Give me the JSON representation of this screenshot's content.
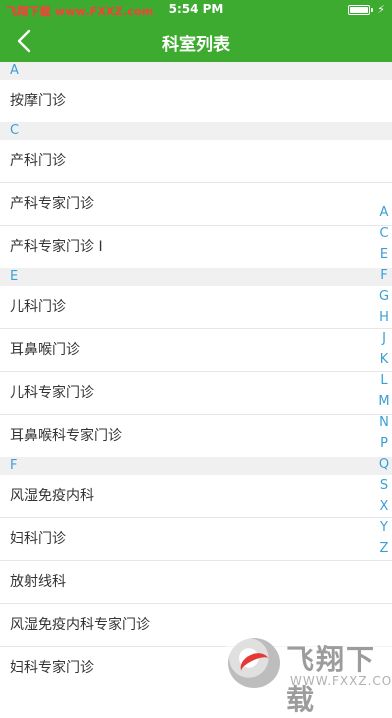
{
  "status_bar": {
    "site": "飞翔下载 www.FXXZ.com",
    "time": "5:54 PM",
    "charge_icon": "⚡"
  },
  "nav": {
    "title": "科室列表",
    "back_icon": "chevron-left-icon"
  },
  "sections": [
    {
      "letter": "A",
      "items": [
        "按摩门诊"
      ]
    },
    {
      "letter": "C",
      "items": [
        "产科门诊",
        "产科专家门诊",
        "产科专家门诊 I"
      ]
    },
    {
      "letter": "E",
      "items": [
        "儿科门诊",
        "耳鼻喉门诊",
        "儿科专家门诊",
        "耳鼻喉科专家门诊"
      ]
    },
    {
      "letter": "F",
      "items": [
        "风湿免疫内科",
        "妇科门诊",
        "放射线科",
        "风湿免疫内科专家门诊",
        "妇科专家门诊"
      ]
    }
  ],
  "index_letters": [
    "A",
    "C",
    "E",
    "F",
    "G",
    "H",
    "J",
    "K",
    "L",
    "M",
    "N",
    "P",
    "Q",
    "S",
    "X",
    "Y",
    "Z"
  ],
  "watermark": {
    "title": "飞翔下载",
    "url": "WWW.FXXZ.COM"
  },
  "colors": {
    "header_green": "#3dab2f",
    "index_blue": "#3a9fd6",
    "section_bg": "#f0f0f0"
  }
}
